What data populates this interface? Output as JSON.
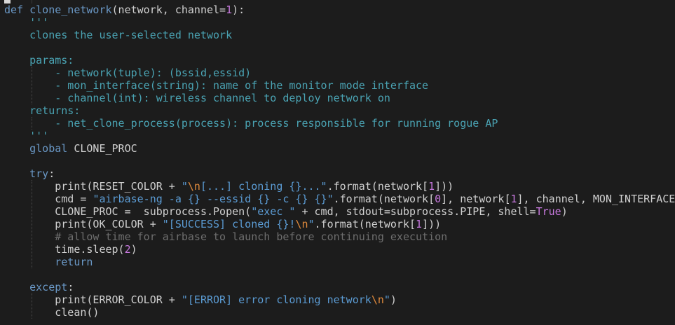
{
  "code": {
    "lines": [
      [
        [
          "kw",
          "def "
        ],
        [
          "fn",
          "clone_network"
        ],
        [
          "t",
          "(network, channel="
        ],
        [
          "num",
          "1"
        ],
        [
          "t",
          "):"
        ]
      ],
      [
        [
          "doc",
          "    '''"
        ]
      ],
      [
        [
          "doc",
          "    clones the user-selected network"
        ]
      ],
      [
        [
          "t",
          ""
        ]
      ],
      [
        [
          "doc",
          "    params:"
        ]
      ],
      [
        [
          "doc",
          "        - network(tuple): (bssid,essid)"
        ]
      ],
      [
        [
          "doc",
          "        - mon_interface(string): name of the monitor mode interface"
        ]
      ],
      [
        [
          "doc",
          "        - channel(int): wireless channel to deploy network on"
        ]
      ],
      [
        [
          "doc",
          "    returns:"
        ]
      ],
      [
        [
          "doc",
          "        - net_clone_process(process): process responsible for running rogue AP"
        ]
      ],
      [
        [
          "doc",
          "    '''"
        ]
      ],
      [
        [
          "kw",
          "    global "
        ],
        [
          "t",
          "CLONE_PROC"
        ]
      ],
      [
        [
          "t",
          ""
        ]
      ],
      [
        [
          "kw",
          "    try"
        ],
        [
          "t",
          ":"
        ]
      ],
      [
        [
          "t",
          "        print(RESET_COLOR + "
        ],
        [
          "str",
          "\""
        ],
        [
          "esc",
          "\\n"
        ],
        [
          "str",
          "[...] cloning {}...\""
        ],
        [
          "t",
          ".format(network["
        ],
        [
          "num",
          "1"
        ],
        [
          "t",
          "]))"
        ]
      ],
      [
        [
          "t",
          "        cmd = "
        ],
        [
          "str",
          "\"airbase-ng -a {} --essid {} -c {} {}\""
        ],
        [
          "t",
          ".format(network["
        ],
        [
          "num",
          "0"
        ],
        [
          "t",
          "], network["
        ],
        [
          "num",
          "1"
        ],
        [
          "t",
          "], channel, MON_INTERFACE"
        ]
      ],
      [
        [
          "t",
          "        CLONE_PROC =  subprocess.Popen("
        ],
        [
          "str",
          "\"exec \""
        ],
        [
          "t",
          " + cmd, stdout=subprocess.PIPE, shell="
        ],
        [
          "bool",
          "True"
        ],
        [
          "t",
          ")"
        ]
      ],
      [
        [
          "t",
          "        print(OK_COLOR + "
        ],
        [
          "str",
          "\"[SUCCESS] cloned {}!"
        ],
        [
          "esc",
          "\\n"
        ],
        [
          "str",
          "\""
        ],
        [
          "t",
          ".format(network["
        ],
        [
          "num",
          "1"
        ],
        [
          "t",
          "]))"
        ]
      ],
      [
        [
          "cmt",
          "        # allow time for airbase to launch before continuing execution"
        ]
      ],
      [
        [
          "t",
          "        time.sleep("
        ],
        [
          "num",
          "2"
        ],
        [
          "t",
          ")"
        ]
      ],
      [
        [
          "kw",
          "        return"
        ]
      ],
      [
        [
          "t",
          ""
        ]
      ],
      [
        [
          "kw",
          "    except"
        ],
        [
          "t",
          ":"
        ]
      ],
      [
        [
          "t",
          "        print(ERROR_COLOR + "
        ],
        [
          "str",
          "\"[ERROR] error cloning network"
        ],
        [
          "esc",
          "\\n"
        ],
        [
          "str",
          "\""
        ],
        [
          "t",
          ")"
        ]
      ],
      [
        [
          "t",
          "        clean()"
        ]
      ]
    ]
  },
  "colors": {
    "background": "#1c1c1c",
    "text": "#d0d0d0",
    "keyword": "#6a98c6",
    "docstring": "#4aa3b3",
    "string": "#5b9bd3",
    "escape": "#e08a3c",
    "number": "#c678dd",
    "comment": "#6e6e6e"
  }
}
